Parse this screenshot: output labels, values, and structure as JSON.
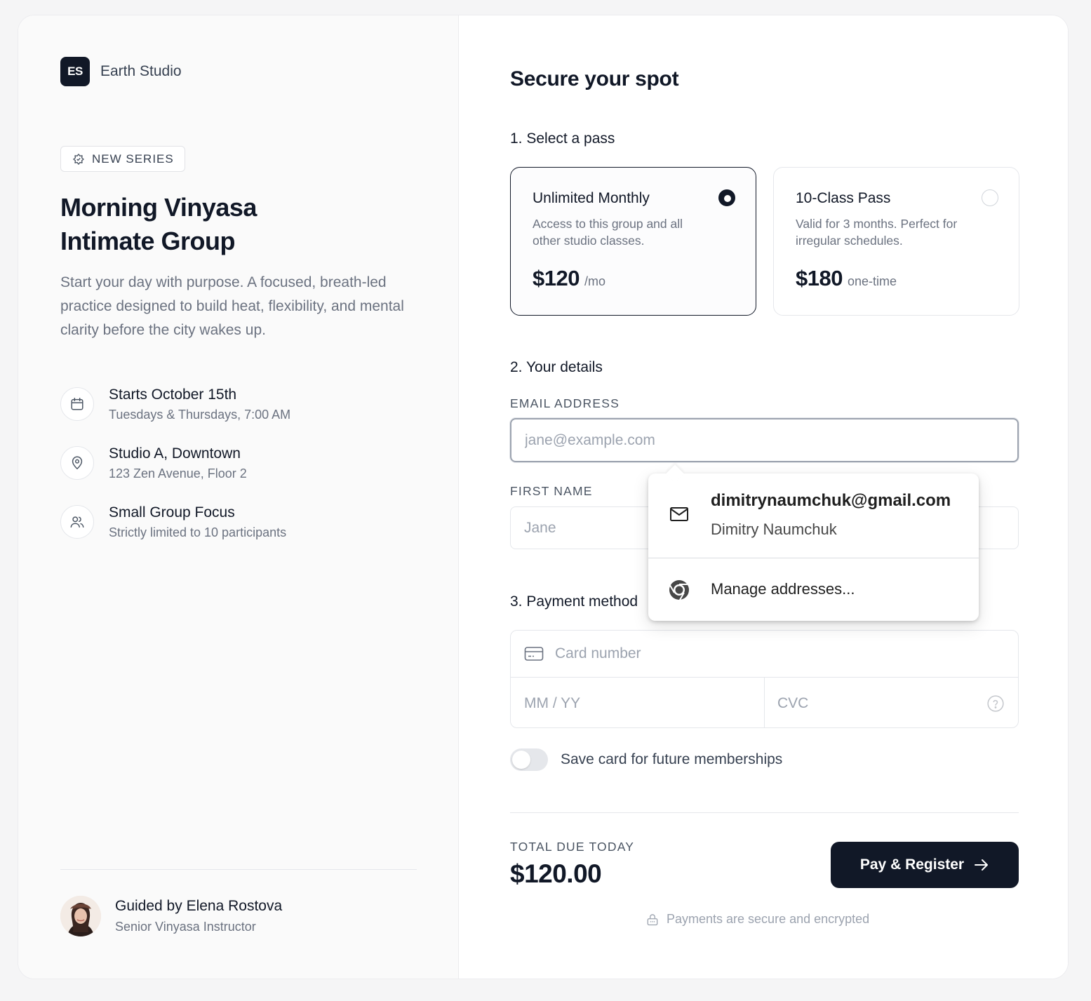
{
  "brand": {
    "initials": "ES",
    "name": "Earth Studio"
  },
  "event": {
    "badge": "NEW SERIES",
    "title_line1": "Morning Vinyasa",
    "title_line2": "Intimate Group",
    "description": "Start your day with purpose. A focused, breath-led practice designed to build heat, flexibility, and mental clarity before the city wakes up.",
    "features": [
      {
        "icon": "calendar-icon",
        "title": "Starts October 15th",
        "subtitle": "Tuesdays & Thursdays, 7:00 AM"
      },
      {
        "icon": "map-pin-icon",
        "title": "Studio A, Downtown",
        "subtitle": "123 Zen Avenue, Floor 2"
      },
      {
        "icon": "users-icon",
        "title": "Small Group Focus",
        "subtitle": "Strictly limited to 10 participants"
      }
    ]
  },
  "instructor": {
    "name": "Guided by Elena Rostova",
    "role": "Senior Vinyasa Instructor"
  },
  "checkout": {
    "heading": "Secure your spot",
    "step1": "1. Select a pass",
    "passes": [
      {
        "name": "Unlimited Monthly",
        "description": "Access to this group and all other studio classes.",
        "price": "$120",
        "unit": "/mo",
        "selected": true
      },
      {
        "name": "10-Class Pass",
        "description": "Valid for 3 months. Perfect for irregular schedules.",
        "price": "$180",
        "unit": "one-time",
        "selected": false
      }
    ],
    "step2": "2. Your details",
    "email_label": "EMAIL ADDRESS",
    "email_placeholder": "jane@example.com",
    "email_value": "",
    "first_name_label": "FIRST NAME",
    "first_name_placeholder": "Jane",
    "step3": "3. Payment method",
    "card_placeholder": "Card number",
    "expiry_placeholder": "MM / YY",
    "cvc_placeholder": "CVC",
    "save_card_label": "Save card for future memberships",
    "save_card_enabled": false,
    "total_label": "TOTAL DUE TODAY",
    "total_amount": "$120.00",
    "pay_button": "Pay & Register",
    "secure_note": "Payments are secure and encrypted"
  },
  "autofill": {
    "suggestion_email": "dimitrynaumchuk@gmail.com",
    "suggestion_name": "Dimitry Naumchuk",
    "manage_label": "Manage addresses..."
  },
  "colors": {
    "primary": "#111827",
    "muted": "#6b7280",
    "placeholder": "#9ca3af",
    "border": "#e5e7eb"
  }
}
